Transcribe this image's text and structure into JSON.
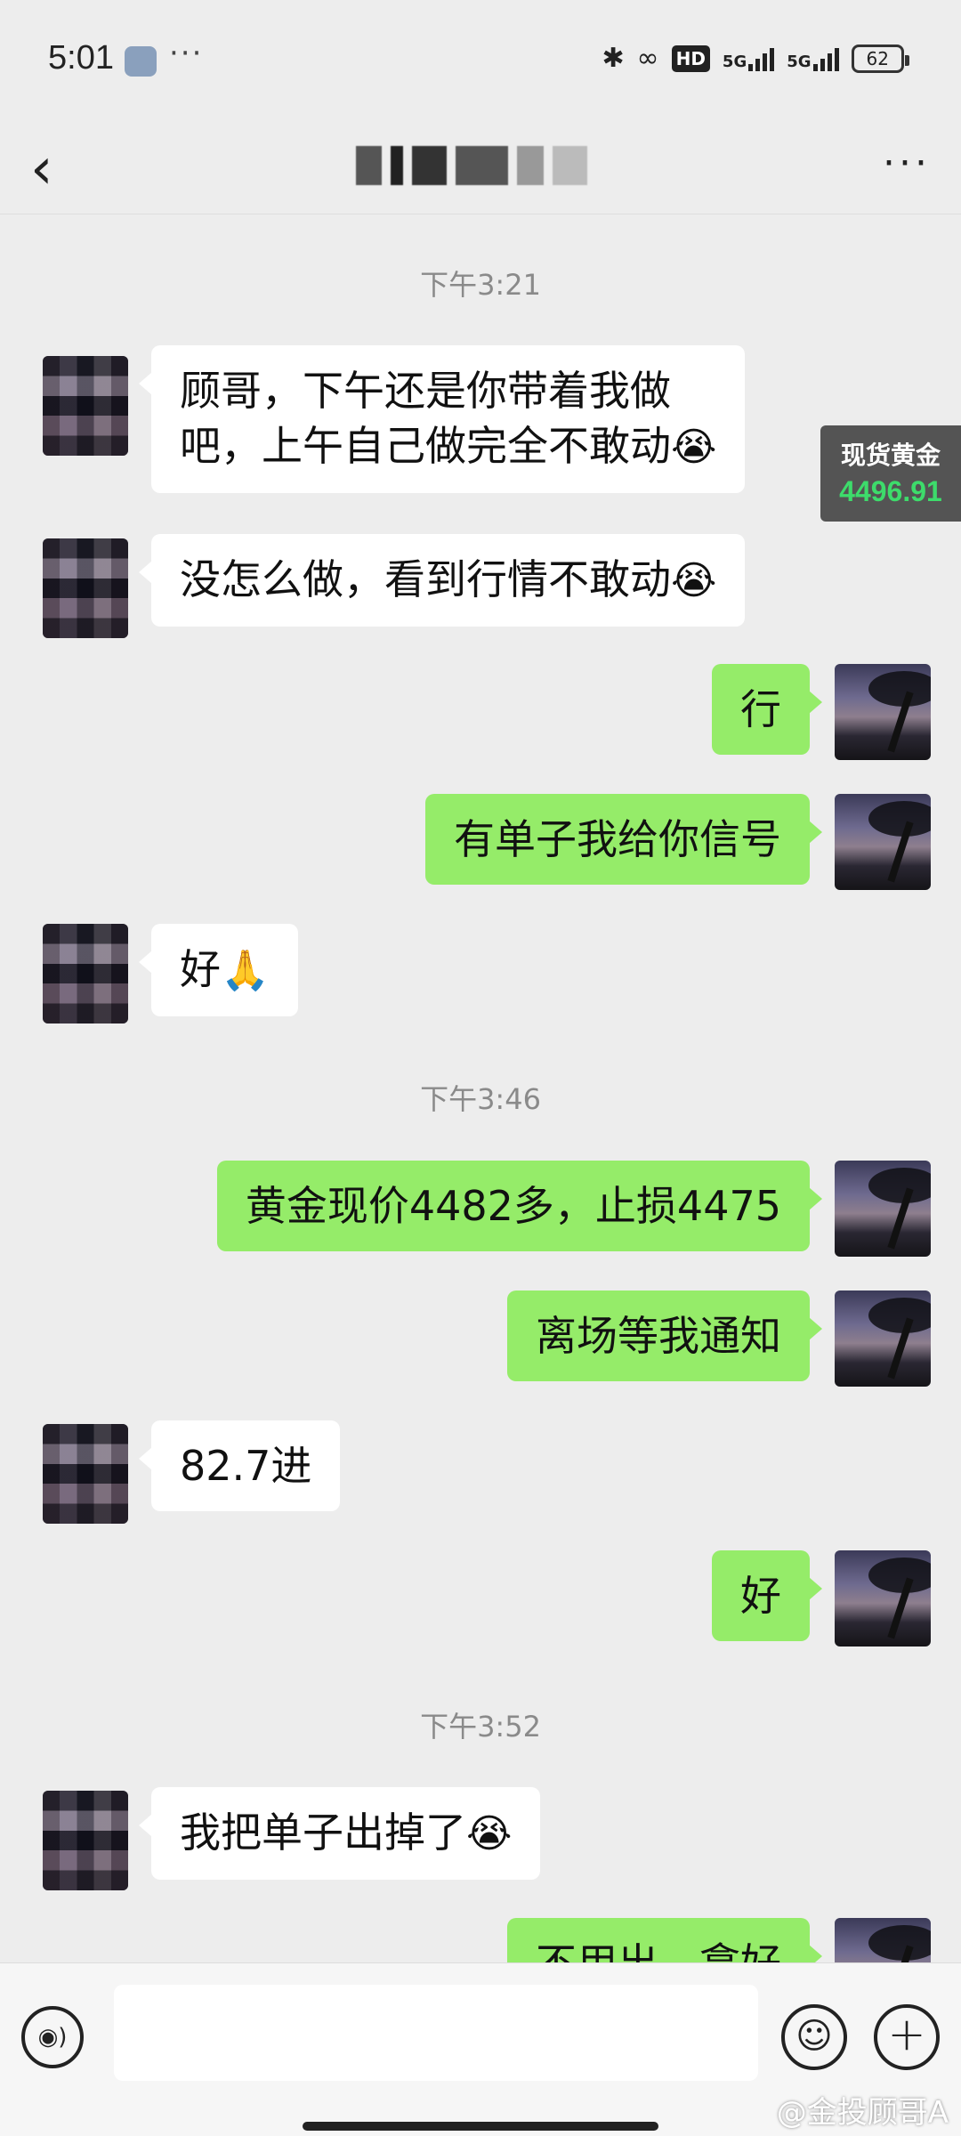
{
  "status_bar": {
    "time": "5:01",
    "dots": "···",
    "network_1": "5G",
    "network_2": "5G",
    "hd_label": "HD",
    "battery": "62"
  },
  "header": {
    "back_icon": "chevron-left-icon",
    "more_icon": "more-dots-icon",
    "more_label": "···"
  },
  "messages": [
    {
      "type": "time",
      "text": "下午3:21"
    },
    {
      "type": "left",
      "text_line1": "顾哥，下午还是你带着我做",
      "text_line2": "吧，上午自己做完全不敢动",
      "emoji": "😭"
    },
    {
      "type": "left",
      "text": "没怎么做，看到行情不敢动",
      "emoji": "😭"
    },
    {
      "type": "right",
      "text": "行"
    },
    {
      "type": "right",
      "text": "有单子我给你信号"
    },
    {
      "type": "left",
      "text": "好",
      "emoji": "🙏"
    },
    {
      "type": "time",
      "text": "下午3:46"
    },
    {
      "type": "right",
      "text": "黄金现价4482多，止损4475"
    },
    {
      "type": "right",
      "text": "离场等我通知"
    },
    {
      "type": "left",
      "text": "82.7进"
    },
    {
      "type": "right",
      "text": "好"
    },
    {
      "type": "time",
      "text": "下午3:52"
    },
    {
      "type": "left",
      "text": "我把单子出掉了",
      "emoji": "😭"
    },
    {
      "type": "right",
      "text": "不用出，拿好"
    }
  ],
  "gold_widget": {
    "title": "现货黄金",
    "price": "4496.91",
    "price_color": "#3ddc6b"
  },
  "input_bar": {
    "voice_icon": "voice-icon",
    "emoji_icon": "emoji-icon",
    "plus_icon": "plus-icon",
    "input_value": "",
    "watermark": "@金投顾哥A"
  },
  "colors": {
    "background": "#ededed",
    "bubble_self": "#95ec69",
    "bubble_other": "#ffffff"
  }
}
